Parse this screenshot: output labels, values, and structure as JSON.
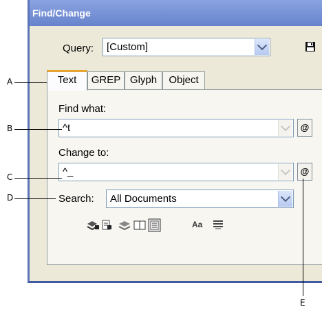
{
  "window": {
    "title": "Find/Change"
  },
  "query": {
    "label": "Query:",
    "value": "[Custom]"
  },
  "tabs": [
    {
      "label": "Text"
    },
    {
      "label": "GREP"
    },
    {
      "label": "Glyph"
    },
    {
      "label": "Object"
    }
  ],
  "find": {
    "label": "Find what:",
    "value": "^t"
  },
  "change": {
    "label": "Change to:",
    "value": "^_"
  },
  "search": {
    "label": "Search:",
    "value": "All Documents"
  },
  "special_char_button": "@",
  "toolbar": {
    "case_label": "Aa"
  },
  "callouts": [
    "A",
    "B",
    "C",
    "D",
    "E"
  ],
  "icons": [
    "save-icon",
    "lock-layers-icon",
    "lock-stories-icon",
    "hidden-layers-icon",
    "master-pages-icon",
    "footnotes-icon",
    "case-sensitive-icon",
    "whole-word-icon"
  ]
}
